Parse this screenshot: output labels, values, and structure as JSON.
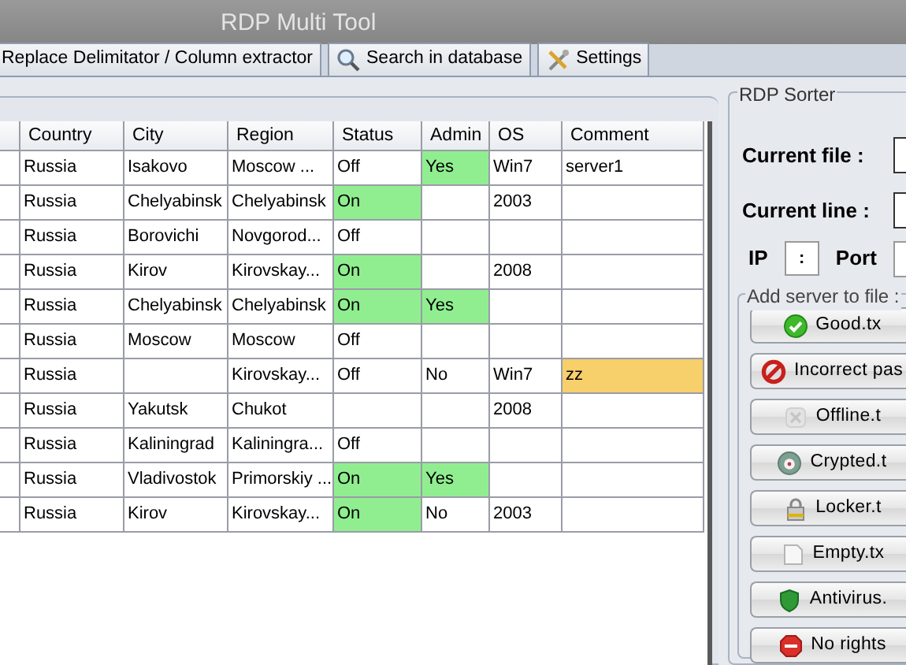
{
  "window": {
    "title": "RDP Multi Tool"
  },
  "tabs": [
    {
      "label": "Replace Delimitator / Column extractor",
      "selected": false
    },
    {
      "label": "Search in database",
      "selected": false
    },
    {
      "label": "Settings",
      "selected": false
    }
  ],
  "table": {
    "columns": [
      "",
      "Country",
      "City",
      "Region",
      "Status",
      "Admin",
      "OS",
      "Comment"
    ],
    "rows": [
      {
        "cells": [
          {},
          {
            "text": "Russia"
          },
          {
            "text": "Isakovo"
          },
          {
            "text": "Moscow ..."
          },
          {
            "text": "Off"
          },
          {
            "text": "Yes",
            "color": "#90ee90"
          },
          {
            "text": "Win7"
          },
          {
            "text": "server1"
          }
        ]
      },
      {
        "cells": [
          {},
          {
            "text": "Russia"
          },
          {
            "text": "Chelyabinsk"
          },
          {
            "text": "Chelyabinsk"
          },
          {
            "text": "On",
            "color": "#90ee90"
          },
          {},
          {
            "text": "2003"
          },
          {}
        ]
      },
      {
        "cells": [
          {},
          {
            "text": "Russia"
          },
          {
            "text": "Borovichi"
          },
          {
            "text": "Novgorod..."
          },
          {
            "text": "Off"
          },
          {},
          {},
          {}
        ]
      },
      {
        "cells": [
          {},
          {
            "text": "Russia"
          },
          {
            "text": "Kirov"
          },
          {
            "text": "Kirovskay..."
          },
          {
            "text": "On",
            "color": "#90ee90"
          },
          {},
          {
            "text": "2008"
          },
          {}
        ]
      },
      {
        "cells": [
          {},
          {
            "text": "Russia"
          },
          {
            "text": "Chelyabinsk"
          },
          {
            "text": "Chelyabinsk"
          },
          {
            "text": "On",
            "color": "#90ee90"
          },
          {
            "text": "Yes",
            "color": "#90ee90"
          },
          {},
          {}
        ]
      },
      {
        "cells": [
          {},
          {
            "text": "Russia"
          },
          {
            "text": "Moscow"
          },
          {
            "text": "Moscow"
          },
          {
            "text": "Off"
          },
          {},
          {},
          {}
        ]
      },
      {
        "cells": [
          {},
          {
            "text": "Russia"
          },
          {},
          {
            "text": "Kirovskay..."
          },
          {
            "text": "Off"
          },
          {
            "text": "No"
          },
          {
            "text": "Win7"
          },
          {
            "text": "zz",
            "color": "#f7cf6b"
          }
        ]
      },
      {
        "cells": [
          {},
          {
            "text": "Russia"
          },
          {
            "text": "Yakutsk"
          },
          {
            "text": "Chukot"
          },
          {},
          {},
          {
            "text": "2008"
          },
          {}
        ]
      },
      {
        "cells": [
          {},
          {
            "text": "Russia"
          },
          {
            "text": "Kaliningrad"
          },
          {
            "text": "Kaliningra..."
          },
          {
            "text": "Off"
          },
          {},
          {},
          {}
        ]
      },
      {
        "cells": [
          {},
          {
            "text": "Russia"
          },
          {
            "text": "Vladivostok"
          },
          {
            "text": "Primorskiy ..."
          },
          {
            "text": "On",
            "color": "#90ee90"
          },
          {
            "text": "Yes",
            "color": "#90ee90"
          },
          {},
          {}
        ]
      },
      {
        "cells": [
          {},
          {
            "text": "Russia"
          },
          {
            "text": "Kirov"
          },
          {
            "text": "Kirovskay..."
          },
          {
            "text": "On",
            "color": "#90ee90"
          },
          {
            "text": "No"
          },
          {
            "text": "2003"
          },
          {}
        ]
      }
    ]
  },
  "sorter": {
    "title": "RDP Sorter",
    "current_file_label": "Current file :",
    "current_line_label": "Current line :",
    "ip_label": "IP",
    "ip_value": ":",
    "port_label": "Port",
    "add_group_title": "Add server to file :",
    "buttons": [
      {
        "label": "Good.tx"
      },
      {
        "label": "Incorrect pas"
      },
      {
        "label": "Offline.t"
      },
      {
        "label": "Crypted.t"
      },
      {
        "label": "Locker.t"
      },
      {
        "label": "Empty.tx"
      },
      {
        "label": "Antivirus."
      },
      {
        "label": "No rights"
      }
    ]
  }
}
